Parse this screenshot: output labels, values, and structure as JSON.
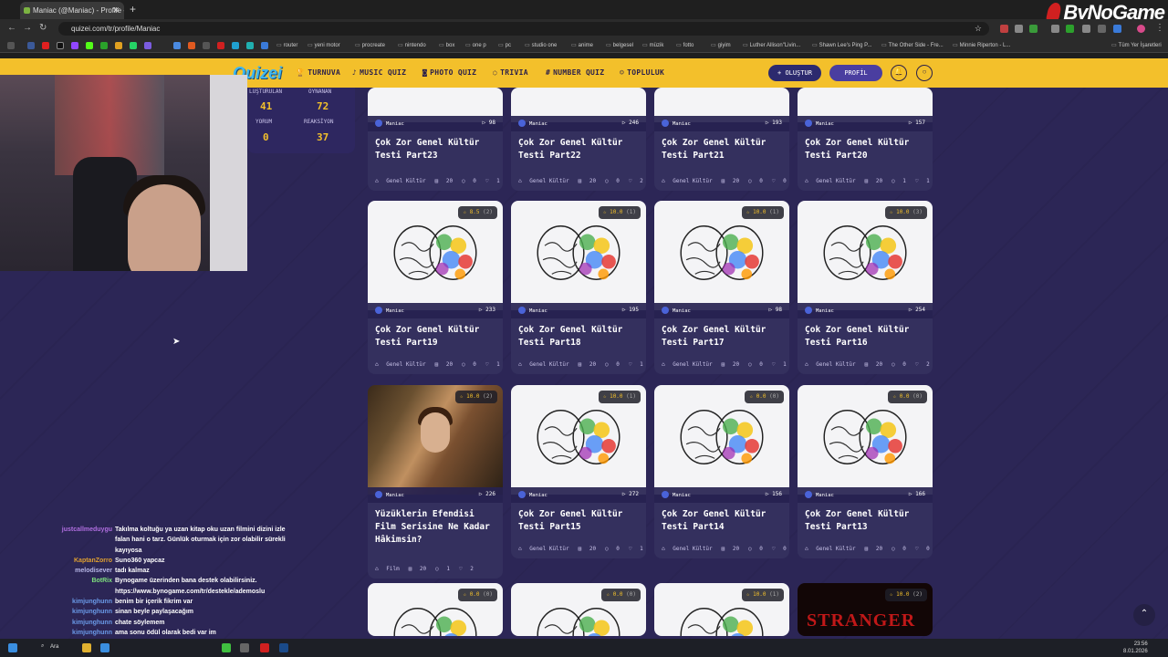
{
  "browser": {
    "tab_title": "Maniac (@Maniac) - Profile - Q",
    "url": "quizei.com/tr/profile/Maniac",
    "brand_overlay": "ByNoGame"
  },
  "bookmarks": [
    "router",
    "yeni motor",
    "procreate",
    "nintendo",
    "box",
    "one p",
    "pc",
    "studio one",
    "anime",
    "belgesel",
    "müzik",
    "fotto",
    "giyim",
    "Luther Allison\"Livin...",
    "Shawn Lee's Ping P...",
    "The Other Side - Fre...",
    "Minnie Riperton - L...",
    "Tüm Yer İşaretleri"
  ],
  "nav": {
    "logo": "Quizei",
    "items": [
      "TURNUVA",
      "MUSIC QUIZ",
      "PHOTO QUIZ",
      "TRIVIA",
      "NUMBER QUIZ",
      "TOPLULUK"
    ],
    "create_label": "+ OLUŞTUR",
    "profile_label": "PROFİL"
  },
  "stats": {
    "created_label": "LUŞTURULAN",
    "created": "41",
    "played_label": "OYNANAN",
    "played": "72",
    "comments_label": "YORUM",
    "comments": "0",
    "reactions_label": "REAKSİYON",
    "reactions": "37"
  },
  "cards": [
    {
      "author": "Maniac",
      "plays": "98",
      "title": "Çok Zor Genel Kültür Testi Part23",
      "category": "Genel Kültür",
      "questions": "20",
      "comments": "0",
      "likes": "1"
    },
    {
      "author": "Maniac",
      "plays": "246",
      "title": "Çok Zor Genel Kültür Testi Part22",
      "category": "Genel Kültür",
      "questions": "20",
      "comments": "0",
      "likes": "2"
    },
    {
      "author": "Maniac",
      "plays": "193",
      "title": "Çok Zor Genel Kültür Testi Part21",
      "category": "Genel Kültür",
      "questions": "20",
      "comments": "0",
      "likes": "0"
    },
    {
      "author": "Maniac",
      "plays": "157",
      "title": "Çok Zor Genel Kültür Testi Part20",
      "category": "Genel Kültür",
      "questions": "20",
      "comments": "1",
      "likes": "1"
    },
    {
      "rating": "8.5",
      "rating_count": "(2)",
      "author": "Maniac",
      "plays": "233",
      "title": "Çok Zor Genel Kültür Testi Part19",
      "category": "Genel Kültür",
      "questions": "20",
      "comments": "0",
      "likes": "1"
    },
    {
      "rating": "10.0",
      "rating_count": "(1)",
      "author": "Maniac",
      "plays": "195",
      "title": "Çok Zor Genel Kültür Testi Part18",
      "category": "Genel Kültür",
      "questions": "20",
      "comments": "0",
      "likes": "1"
    },
    {
      "rating": "10.0",
      "rating_count": "(1)",
      "author": "Maniac",
      "plays": "98",
      "title": "Çok Zor Genel Kültür Testi Part17",
      "category": "Genel Kültür",
      "questions": "20",
      "comments": "0",
      "likes": "1"
    },
    {
      "rating": "10.0",
      "rating_count": "(3)",
      "author": "Maniac",
      "plays": "254",
      "title": "Çok Zor Genel Kültür Testi Part16",
      "category": "Genel Kültür",
      "questions": "20",
      "comments": "0",
      "likes": "2"
    },
    {
      "rating": "10.0",
      "rating_count": "(2)",
      "author": "Maniac",
      "plays": "226",
      "title": "Yüzüklerin Efendisi Film Serisine Ne Kadar Hâkimsin?",
      "category": "Film",
      "questions": "20",
      "comments": "1",
      "likes": "2"
    },
    {
      "rating": "10.0",
      "rating_count": "(1)",
      "author": "Maniac",
      "plays": "272",
      "title": "Çok Zor Genel Kültür Testi Part15",
      "category": "Genel Kültür",
      "questions": "20",
      "comments": "0",
      "likes": "1"
    },
    {
      "rating": "0.0",
      "rating_count": "(0)",
      "author": "Maniac",
      "plays": "156",
      "title": "Çok Zor Genel Kültür Testi Part14",
      "category": "Genel Kültür",
      "questions": "20",
      "comments": "0",
      "likes": "0"
    },
    {
      "rating": "0.0",
      "rating_count": "(0)",
      "author": "Maniac",
      "plays": "166",
      "title": "Çok Zor Genel Kültür Testi Part13",
      "category": "Genel Kültür",
      "questions": "20",
      "comments": "0",
      "likes": "0"
    },
    {
      "rating": "0.0",
      "rating_count": "(0)"
    },
    {
      "rating": "0.0",
      "rating_count": "(0)"
    },
    {
      "rating": "10.0",
      "rating_count": "(1)"
    },
    {
      "rating": "10.0",
      "rating_count": "(2)",
      "thumb_text": "STRANGER"
    }
  ],
  "chat": [
    {
      "user": "justcallmeduygu",
      "color": "#b06ee0",
      "msg": "Takılma koltuğu ya uzan kitap oku uzan filmini dizini izle falan hani o tarz. Günlük oturmak için zor olabilir sürekli kayıyosa"
    },
    {
      "user": "KaptanZorro",
      "color": "#e0a030",
      "msg": "Suno360 yapcaz"
    },
    {
      "user": "melodisever",
      "color": "#b8b8e8",
      "msg": "tadı kalmaz"
    },
    {
      "user": "BotRix",
      "color": "#7ee07e",
      "msg": "Bynogame üzerinden bana destek olabilirsiniz. https://www.bynogame.com/tr/destekle/ademoslu"
    },
    {
      "user": "kimjunghunn",
      "color": "#6a9ae8",
      "msg": "benim bir içerik fikrim var"
    },
    {
      "user": "kimjunghunn",
      "color": "#6a9ae8",
      "msg": "sinan beyle paylaşacağım"
    },
    {
      "user": "kimjunghunn",
      "color": "#6a9ae8",
      "msg": "chate söylemem"
    },
    {
      "user": "kimjunghunn",
      "color": "#6a9ae8",
      "msg": "ama sonu ödül olarak bedi var im"
    }
  ],
  "taskbar": {
    "search": "Ara",
    "time": "23:56",
    "date": "8.01.2026"
  }
}
